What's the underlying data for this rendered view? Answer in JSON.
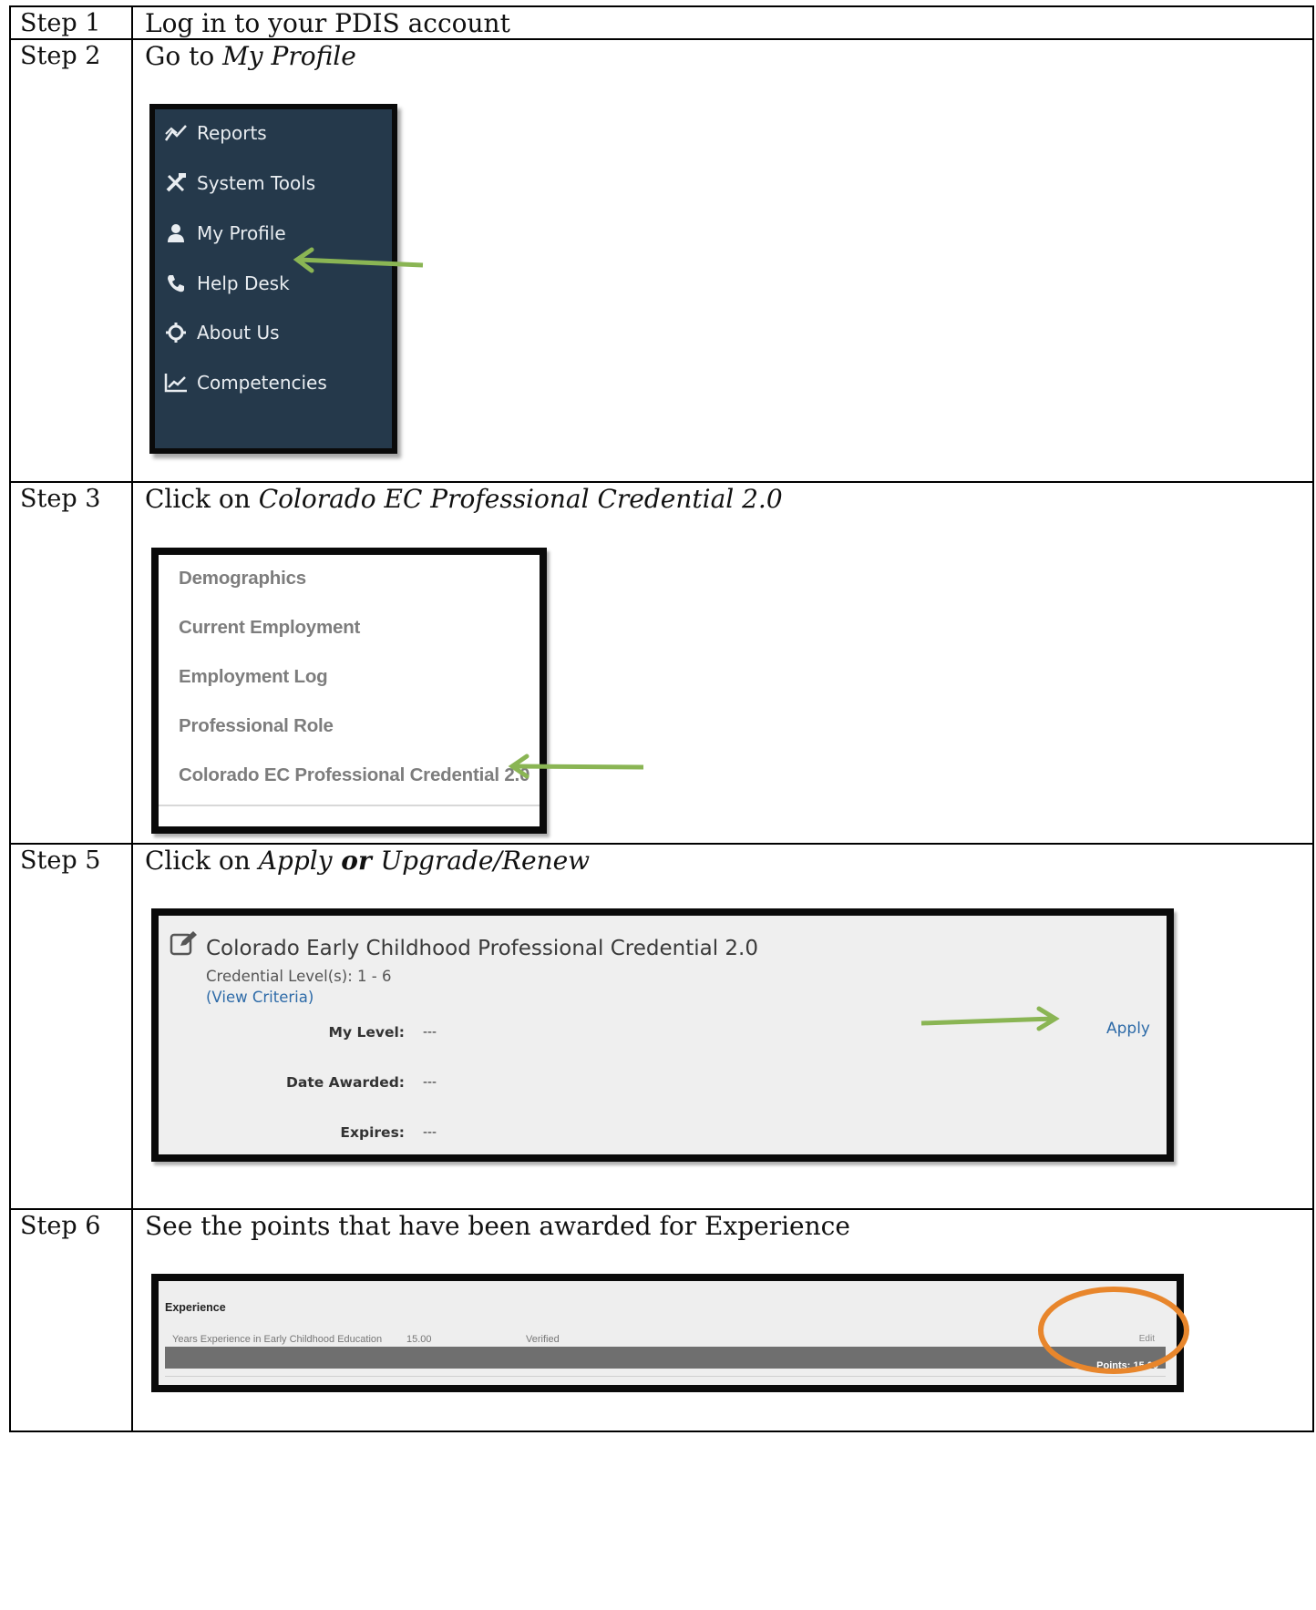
{
  "steps": [
    {
      "label": "Step 1",
      "instruction": "Log in to your PDIS account"
    },
    {
      "label": "Step 2",
      "instruction_prefix": "Go to ",
      "instruction_emphasis": "My Profile",
      "menu": {
        "items": [
          {
            "label": "Reports",
            "icon": "reports-icon"
          },
          {
            "label": "System Tools",
            "icon": "tools-icon"
          },
          {
            "label": "My Profile",
            "icon": "user-icon"
          },
          {
            "label": "Help Desk",
            "icon": "phone-icon"
          },
          {
            "label": "About Us",
            "icon": "gear-icon"
          },
          {
            "label": "Competencies",
            "icon": "chart-icon"
          }
        ]
      }
    },
    {
      "label": "Step 3",
      "instruction_prefix": "Click on ",
      "instruction_emphasis": "Colorado EC Professional Credential 2.0",
      "menu": {
        "items": [
          {
            "label": "Demographics"
          },
          {
            "label": "Current Employment"
          },
          {
            "label": "Employment Log"
          },
          {
            "label": "Professional Role"
          },
          {
            "label": "Colorado EC Professional Credential 2.0"
          }
        ]
      }
    },
    {
      "label": "Step 5",
      "instruction_prefix": "Click on ",
      "instruction_emphasis": "Apply",
      "instruction_connector": " or ",
      "instruction_emphasis2": "Upgrade/Renew",
      "card": {
        "title": "Colorado Early Childhood Professional Credential 2.0",
        "levels": "Credential Level(s): 1 - 6",
        "criteria_link": "(View Criteria)",
        "rows": [
          {
            "label": "My Level:",
            "value": "---"
          },
          {
            "label": "Date Awarded:",
            "value": "---"
          },
          {
            "label": "Expires:",
            "value": "---"
          }
        ],
        "apply": "Apply"
      }
    },
    {
      "label": "Step 6",
      "instruction": "See the points that have been awarded for Experience",
      "panel": {
        "heading": "Experience",
        "row_label": "Years Experience in Early Childhood Education",
        "row_value": "15.00",
        "row_status": "Verified",
        "edit": "Edit",
        "points": "Points: 15.00"
      }
    }
  ],
  "colors": {
    "arrow": "#8ab554",
    "highlight_ellipse": "#e8862c",
    "nav_bg": "#25394b",
    "link": "#2e6ba8"
  }
}
